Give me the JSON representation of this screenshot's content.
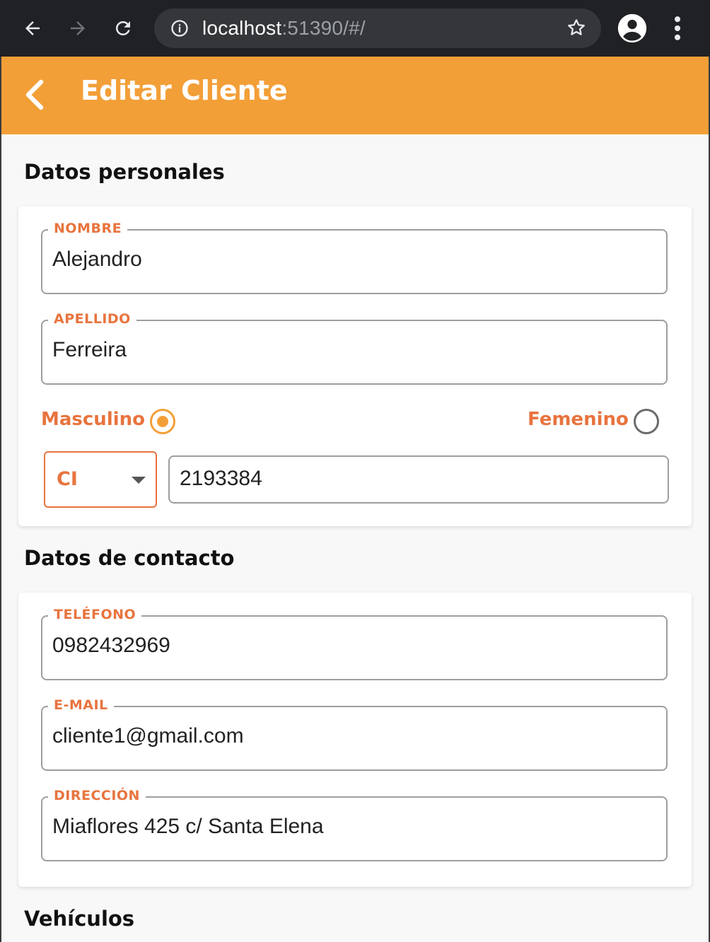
{
  "browser": {
    "url_host": "localhost",
    "url_rest": ":51390/#/",
    "icons": [
      "back-arrow-icon",
      "forward-arrow-icon",
      "reload-icon",
      "info-icon",
      "star-icon",
      "account-icon",
      "more-vert-icon"
    ]
  },
  "appbar": {
    "title": "Editar Cliente",
    "color": "#f39f38",
    "back_icon": "chevron-left-icon"
  },
  "sections": {
    "personal": {
      "title": "Datos personales",
      "nombre": {
        "label": "NOMBRE",
        "value": "Alejandro"
      },
      "apellido": {
        "label": "APELLIDO",
        "value": "Ferreira"
      },
      "gender": {
        "masculino": "Masculino",
        "femenino": "Femenino",
        "selected": "Masculino"
      },
      "doc_type": {
        "value": "CI"
      },
      "doc_number": {
        "value": "2193384"
      }
    },
    "contact": {
      "title": "Datos de contacto",
      "telefono": {
        "label": "TELÉFONO",
        "value": "0982432969"
      },
      "email": {
        "label": "E-MAIL",
        "value": "cliente1@gmail.com"
      },
      "direccion": {
        "label": "DIRECCIÓN",
        "value": "Miaflores 425 c/ Santa Elena"
      }
    },
    "vehiculos": {
      "title": "Vehículos"
    }
  },
  "colors": {
    "accent": "#e8743e",
    "primary": "#f39f38",
    "border": "#9e9e9e"
  }
}
